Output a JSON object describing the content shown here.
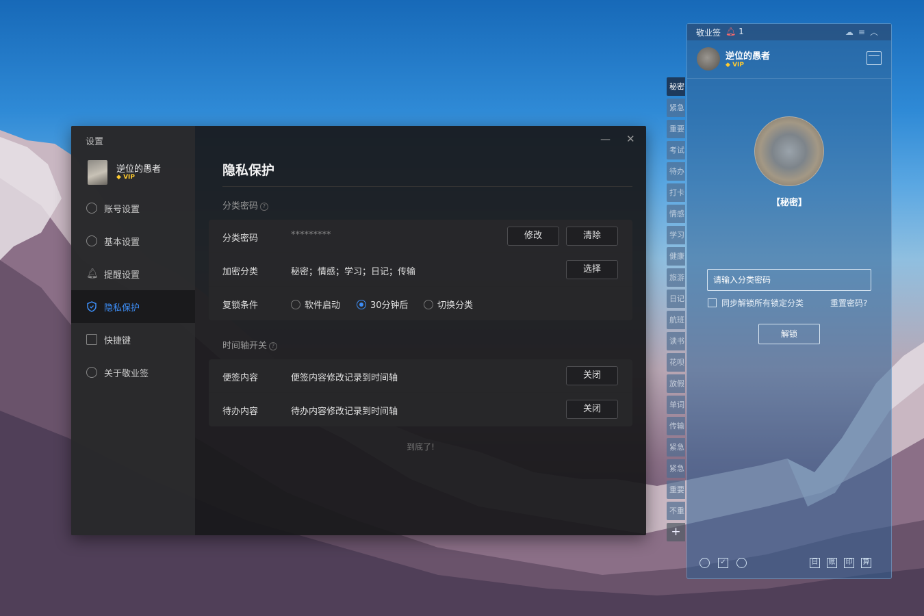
{
  "settings": {
    "title": "设置",
    "user": {
      "name": "逆位的愚者",
      "badge": "VIP"
    },
    "nav": [
      {
        "label": "账号设置"
      },
      {
        "label": "基本设置"
      },
      {
        "label": "提醒设置"
      },
      {
        "label": "隐私保护"
      },
      {
        "label": "快捷键"
      },
      {
        "label": "关于敬业签"
      }
    ],
    "page_title": "隐私保护",
    "section_password": "分类密码",
    "rows": {
      "password": {
        "label": "分类密码",
        "value": "*********",
        "modify": "修改",
        "clear": "清除"
      },
      "encrypted": {
        "label": "加密分类",
        "value": "秘密；情感；学习；日记；传输",
        "select": "选择"
      },
      "relock": {
        "label": "复锁条件",
        "options": [
          "软件启动",
          "30分钟后",
          "切换分类"
        ],
        "selected": "30分钟后"
      }
    },
    "section_timeline": "时间轴开关",
    "timeline": {
      "notes": {
        "label": "便签内容",
        "desc": "便签内容修改记录到时间轴",
        "button": "关闭"
      },
      "todos": {
        "label": "待办内容",
        "desc": "待办内容修改记录到时间轴",
        "button": "关闭"
      }
    },
    "end_text": "到底了!"
  },
  "widget": {
    "app_name": "敬业签",
    "notify_count": "1",
    "user": {
      "name": "逆位的愚者",
      "badge": "VIP"
    },
    "locked_category": "【秘密】",
    "password_placeholder": "请输入分类密码",
    "sync_unlock": "同步解锁所有锁定分类",
    "reset_password": "重置密码?",
    "unlock": "解锁",
    "tabs": [
      "秘密",
      "紧急",
      "重要",
      "考试",
      "待办",
      "打卡",
      "情感",
      "学习",
      "健康",
      "旅游",
      "日记",
      "航班",
      "读书",
      "花呗",
      "放假",
      "单词",
      "传输",
      "紧急",
      "紧急",
      "重要",
      "不重"
    ],
    "active_tab": "秘密",
    "bottom_right": [
      "日",
      "账",
      "印",
      "算"
    ]
  },
  "colors": {
    "accent": "#3d8df5",
    "vip": "#ffcb2f"
  }
}
